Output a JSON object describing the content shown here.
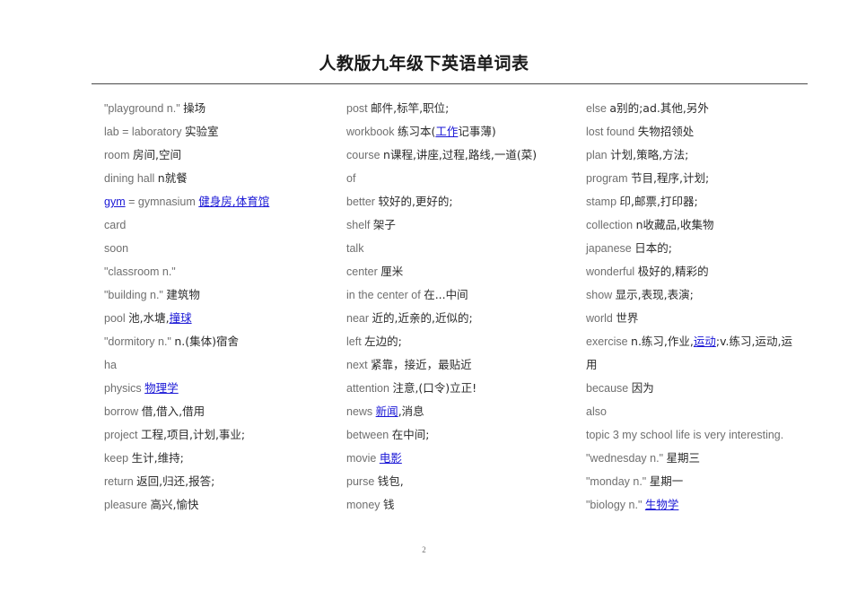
{
  "document": {
    "title": "人教版九年级下英语单词表",
    "page_number": "2"
  },
  "columns": [
    {
      "id": "column-1",
      "entries": [
        {
          "en": "\"playground  n.\"",
          "cn": "操场"
        },
        {
          "en": "lab = laboratory",
          "cn": "实验室"
        },
        {
          "en": "room",
          "cn": "房间,空间"
        },
        {
          "en": "dining  hall",
          "cn": "n就餐"
        },
        {
          "en_link": "gym",
          "en": "= gymnasium",
          "cn_link": "健身房,体育馆"
        },
        {
          "en": "card",
          "cn": ""
        },
        {
          "en": "soon",
          "cn": ""
        },
        {
          "en": "\"classroom  n.\"",
          "cn": ""
        },
        {
          "en": "\"building  n.\"",
          "cn": "建筑物"
        },
        {
          "en": "pool",
          "cn": "池,水塘,",
          "cn_link": "撞球"
        },
        {
          "en": "\"dormitory  n.\"",
          "cn": "n.(集体)宿舍"
        },
        {
          "en": "ha",
          "cn": ""
        },
        {
          "en": "physics",
          "cn_link": "物理学"
        },
        {
          "en": "borrow",
          "cn": "借,借入,借用"
        },
        {
          "en": "project",
          "cn": "工程,项目,计划,事业;"
        },
        {
          "en": "keep",
          "cn": "生计,维持;"
        },
        {
          "en": "return",
          "cn": "返回,归还,报答;"
        },
        {
          "en": "pleasure",
          "cn": "高兴,愉快"
        }
      ]
    },
    {
      "id": "column-2",
      "entries": [
        {
          "en": "post",
          "cn": "邮件,标竿,职位;"
        },
        {
          "en": "workbook",
          "cn": "练习本(",
          "cn_link": "工作",
          "cn_tail": "记事薄)"
        },
        {
          "en": "course",
          "cn": "n课程,讲座,过程,路线,一道(菜)"
        },
        {
          "en": "of",
          "cn": ""
        },
        {
          "en": "better",
          "cn": "较好的,更好的;"
        },
        {
          "en": "shelf",
          "cn": "架子"
        },
        {
          "en": "talk",
          "cn": ""
        },
        {
          "en": "center",
          "cn": "厘米"
        },
        {
          "en": "in  the  center  of",
          "cn": "在...中间"
        },
        {
          "en": "near",
          "cn": "近的,近亲的,近似的;"
        },
        {
          "en": "left",
          "cn": "左边的;"
        },
        {
          "en": "next",
          "cn": "紧靠，接近，最贴近"
        },
        {
          "en": "attention",
          "cn": "注意,(口令)立正!"
        },
        {
          "en": "news",
          "cn_link": "新闻",
          "cn_tail": ",消息"
        },
        {
          "en": "between",
          "cn": "在中间;"
        },
        {
          "en": "movie",
          "cn_link": "电影"
        },
        {
          "en": "purse",
          "cn": "钱包,"
        },
        {
          "en": "money",
          "cn": "钱"
        }
      ]
    },
    {
      "id": "column-3",
      "entries": [
        {
          "en": "else",
          "cn": "a别的;ad.其他,另外"
        },
        {
          "en": "lost  found",
          "cn": "失物招领处"
        },
        {
          "en": "plan",
          "cn": "计划,策略,方法;"
        },
        {
          "en": "program",
          "cn": "节目,程序,计划;"
        },
        {
          "en": "stamp",
          "cn": "印,邮票,打印器;"
        },
        {
          "en": "collection",
          "cn": "n收藏品,收集物"
        },
        {
          "en": "japanese",
          "cn": "日本的;"
        },
        {
          "en": "wonderful",
          "cn": "极好的,精彩的"
        },
        {
          "en": "show",
          "cn": "显示,表现,表演;"
        },
        {
          "en": "world",
          "cn": "世界"
        },
        {
          "en": "exercise",
          "cn": "n.练习,作业,",
          "cn_link": "运动",
          "cn_tail": ";v.练习,运动,运",
          "continuation": "用"
        },
        {
          "en": "because",
          "cn": "因为"
        },
        {
          "en": "also",
          "cn": ""
        },
        {
          "en": "topic  3  my  school  life  is  very  interesting.",
          "cn": ""
        },
        {
          "en": "\"wednesday  n.\"",
          "cn": "星期三"
        },
        {
          "en": "\"monday  n.\"",
          "cn": "星期一"
        },
        {
          "en": "\"biology  n.\"",
          "cn_link": "生物学"
        }
      ]
    }
  ]
}
